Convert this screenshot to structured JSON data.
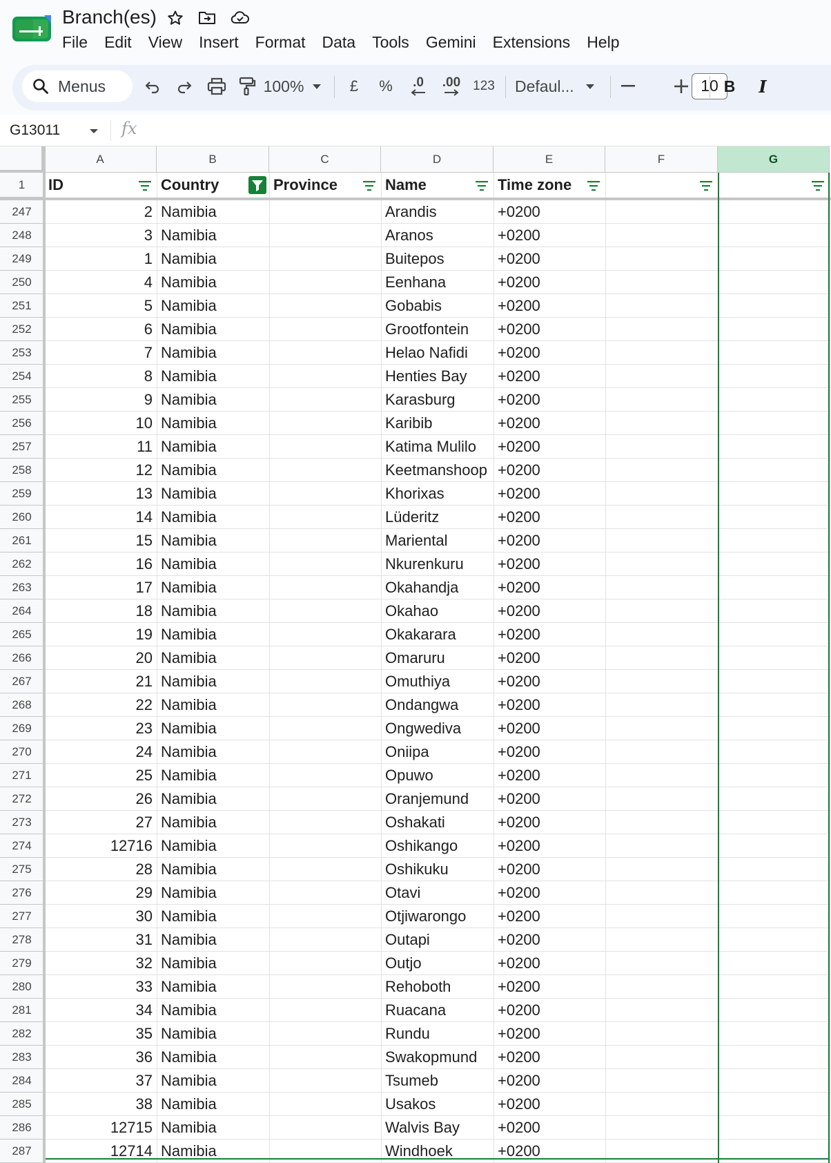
{
  "app": {
    "doc_title": "Branch(es)",
    "menu": [
      "File",
      "Edit",
      "View",
      "Insert",
      "Format",
      "Data",
      "Tools",
      "Gemini",
      "Extensions",
      "Help"
    ]
  },
  "toolbar": {
    "search_label": "Menus",
    "zoom": "100%",
    "currency": "£",
    "percent": "%",
    "decrease_decimal": ".0",
    "increase_decimal": ".00",
    "number_format": "123",
    "font": "Defaul...",
    "font_size": "10",
    "bold": "B",
    "italic": "I"
  },
  "formula_bar": {
    "name_box": "G13011",
    "fx": "fx"
  },
  "colors": {
    "accent_green": "#188038",
    "selected_header": "#c2e7d0",
    "toolbar_bg": "#edf2fa"
  },
  "sheet": {
    "column_letters": [
      "A",
      "B",
      "C",
      "D",
      "E",
      "F",
      "G"
    ],
    "selected_column": "G",
    "header_row_number": "1",
    "headers": [
      "ID",
      "Country",
      "Province",
      "Name",
      "Time zone",
      "",
      ""
    ],
    "filtered_column": "B",
    "rows": [
      {
        "row": "247",
        "id": "2",
        "country": "Namibia",
        "name": "Arandis",
        "tz": "+0200"
      },
      {
        "row": "248",
        "id": "3",
        "country": "Namibia",
        "name": "Aranos",
        "tz": "+0200"
      },
      {
        "row": "249",
        "id": "1",
        "country": "Namibia",
        "name": "Buitepos",
        "tz": "+0200"
      },
      {
        "row": "250",
        "id": "4",
        "country": "Namibia",
        "name": "Eenhana",
        "tz": "+0200"
      },
      {
        "row": "251",
        "id": "5",
        "country": "Namibia",
        "name": "Gobabis",
        "tz": "+0200"
      },
      {
        "row": "252",
        "id": "6",
        "country": "Namibia",
        "name": "Grootfontein",
        "tz": "+0200"
      },
      {
        "row": "253",
        "id": "7",
        "country": "Namibia",
        "name": "Helao Nafidi",
        "tz": "+0200"
      },
      {
        "row": "254",
        "id": "8",
        "country": "Namibia",
        "name": "Henties Bay",
        "tz": "+0200"
      },
      {
        "row": "255",
        "id": "9",
        "country": "Namibia",
        "name": "Karasburg",
        "tz": "+0200"
      },
      {
        "row": "256",
        "id": "10",
        "country": "Namibia",
        "name": "Karibib",
        "tz": "+0200"
      },
      {
        "row": "257",
        "id": "11",
        "country": "Namibia",
        "name": "Katima Mulilo",
        "tz": "+0200"
      },
      {
        "row": "258",
        "id": "12",
        "country": "Namibia",
        "name": "Keetmanshoop",
        "tz": "+0200"
      },
      {
        "row": "259",
        "id": "13",
        "country": "Namibia",
        "name": "Khorixas",
        "tz": "+0200"
      },
      {
        "row": "260",
        "id": "14",
        "country": "Namibia",
        "name": "Lüderitz",
        "tz": "+0200"
      },
      {
        "row": "261",
        "id": "15",
        "country": "Namibia",
        "name": "Mariental",
        "tz": "+0200"
      },
      {
        "row": "262",
        "id": "16",
        "country": "Namibia",
        "name": "Nkurenkuru",
        "tz": "+0200"
      },
      {
        "row": "263",
        "id": "17",
        "country": "Namibia",
        "name": "Okahandja",
        "tz": "+0200"
      },
      {
        "row": "264",
        "id": "18",
        "country": "Namibia",
        "name": "Okahao",
        "tz": "+0200"
      },
      {
        "row": "265",
        "id": "19",
        "country": "Namibia",
        "name": "Okakarara",
        "tz": "+0200"
      },
      {
        "row": "266",
        "id": "20",
        "country": "Namibia",
        "name": "Omaruru",
        "tz": "+0200"
      },
      {
        "row": "267",
        "id": "21",
        "country": "Namibia",
        "name": "Omuthiya",
        "tz": "+0200"
      },
      {
        "row": "268",
        "id": "22",
        "country": "Namibia",
        "name": "Ondangwa",
        "tz": "+0200"
      },
      {
        "row": "269",
        "id": "23",
        "country": "Namibia",
        "name": "Ongwediva",
        "tz": "+0200"
      },
      {
        "row": "270",
        "id": "24",
        "country": "Namibia",
        "name": "Oniipa",
        "tz": "+0200"
      },
      {
        "row": "271",
        "id": "25",
        "country": "Namibia",
        "name": "Opuwo",
        "tz": "+0200"
      },
      {
        "row": "272",
        "id": "26",
        "country": "Namibia",
        "name": "Oranjemund",
        "tz": "+0200"
      },
      {
        "row": "273",
        "id": "27",
        "country": "Namibia",
        "name": "Oshakati",
        "tz": "+0200"
      },
      {
        "row": "274",
        "id": "12716",
        "country": "Namibia",
        "name": "Oshikango",
        "tz": "+0200"
      },
      {
        "row": "275",
        "id": "28",
        "country": "Namibia",
        "name": "Oshikuku",
        "tz": "+0200"
      },
      {
        "row": "276",
        "id": "29",
        "country": "Namibia",
        "name": "Otavi",
        "tz": "+0200"
      },
      {
        "row": "277",
        "id": "30",
        "country": "Namibia",
        "name": "Otjiwarongo",
        "tz": "+0200"
      },
      {
        "row": "278",
        "id": "31",
        "country": "Namibia",
        "name": "Outapi",
        "tz": "+0200"
      },
      {
        "row": "279",
        "id": "32",
        "country": "Namibia",
        "name": "Outjo",
        "tz": "+0200"
      },
      {
        "row": "280",
        "id": "33",
        "country": "Namibia",
        "name": "Rehoboth",
        "tz": "+0200"
      },
      {
        "row": "281",
        "id": "34",
        "country": "Namibia",
        "name": "Ruacana",
        "tz": "+0200"
      },
      {
        "row": "282",
        "id": "35",
        "country": "Namibia",
        "name": "Rundu",
        "tz": "+0200"
      },
      {
        "row": "283",
        "id": "36",
        "country": "Namibia",
        "name": "Swakopmund",
        "tz": "+0200"
      },
      {
        "row": "284",
        "id": "37",
        "country": "Namibia",
        "name": "Tsumeb",
        "tz": "+0200"
      },
      {
        "row": "285",
        "id": "38",
        "country": "Namibia",
        "name": "Usakos",
        "tz": "+0200"
      },
      {
        "row": "286",
        "id": "12715",
        "country": "Namibia",
        "name": "Walvis Bay",
        "tz": "+0200"
      },
      {
        "row": "287",
        "id": "12714",
        "country": "Namibia",
        "name": "Windhoek",
        "tz": "+0200"
      }
    ]
  }
}
